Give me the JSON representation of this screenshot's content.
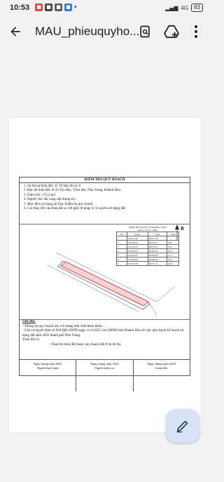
{
  "status_bar": {
    "time": "10:53",
    "network": "4G",
    "battery": "83"
  },
  "app_bar": {
    "title": "MAU_phieuquyho...",
    "icons": [
      "back-arrow-icon",
      "document-search-icon",
      "drive-add-icon",
      "more-vert-icon"
    ]
  },
  "document": {
    "heading": "KIỂM TRA QUY HOẠCH",
    "lines": [
      "1.  Số thứ tự thửa đất:   32        Tờ bản đồ số: 8",
      "2.  Địa chỉ thửa đất: tổ 24 Tây Bắc, Vĩnh Hải, Nha Trang, Khánh Hòa.",
      "3.  Diện tích: 173,2 m2",
      "4.  Người yêu cầu cung cấp thông tin:",
      "5.  Mục đích sử dụng tài liệu: Kiểm tra quy hoạch",
      "6.  Các thay đổi của thửa đất so với giấy tờ pháp lý về quyền sử dụng đất:"
    ],
    "coord_table_title": "BẢNG KÊ TỌA ĐỘ VÀ KHOẢNG CÁCH",
    "coord_table_subtitle": "(Hệ tọa độ VN - 2000)",
    "coord_headers": [
      "STT",
      "X (m)",
      "Y (m)",
      "S (m)"
    ],
    "coord_rows": [
      [
        "1",
        "1319717.80",
        "601577.14",
        ""
      ],
      [
        "2",
        "1319728.35",
        "601577.21",
        "0.49"
      ],
      [
        "3",
        "1319732.14",
        "601578.75",
        "4.25"
      ],
      [
        "4",
        "1319726.92",
        "601483.18",
        "95.71"
      ],
      [
        "5",
        "1319718.43",
        "601483.63",
        "27.17"
      ],
      [
        "6",
        "1319709.73",
        "601485.80",
        "6.78"
      ],
      [
        "7",
        "1319717.80",
        "601577.14",
        "34.71"
      ]
    ],
    "plan_label_b": "B",
    "notes_title": "Ghi chú:",
    "notes": [
      "-  Thông tin quy hoạch này chỉ mang tính chất tham khảo.",
      "-  Căn cứ Quyết định số 950/QĐ-UBND ngày 11/4/2025 của UBND tỉnh Khánh Hòa về việc phê duyệt kế hoạch sử dụng đất năm 2025 thành phố Nha Trang:",
      "Thửa đất có:",
      "+ Toàn bộ thửa đất thuộc quy hoạch đất ở tại đô thị."
    ],
    "signatures": [
      {
        "date": "Ngày   tháng   năm 2025",
        "role": "Người thực hiện"
      },
      {
        "date": "Ngày   tháng   năm 2025",
        "role": "Người kiểm tra"
      },
      {
        "date": "Ngày   tháng   năm 2025",
        "role": "Giám đốc"
      }
    ]
  },
  "fab": {
    "icon": "edit-pen-icon"
  }
}
